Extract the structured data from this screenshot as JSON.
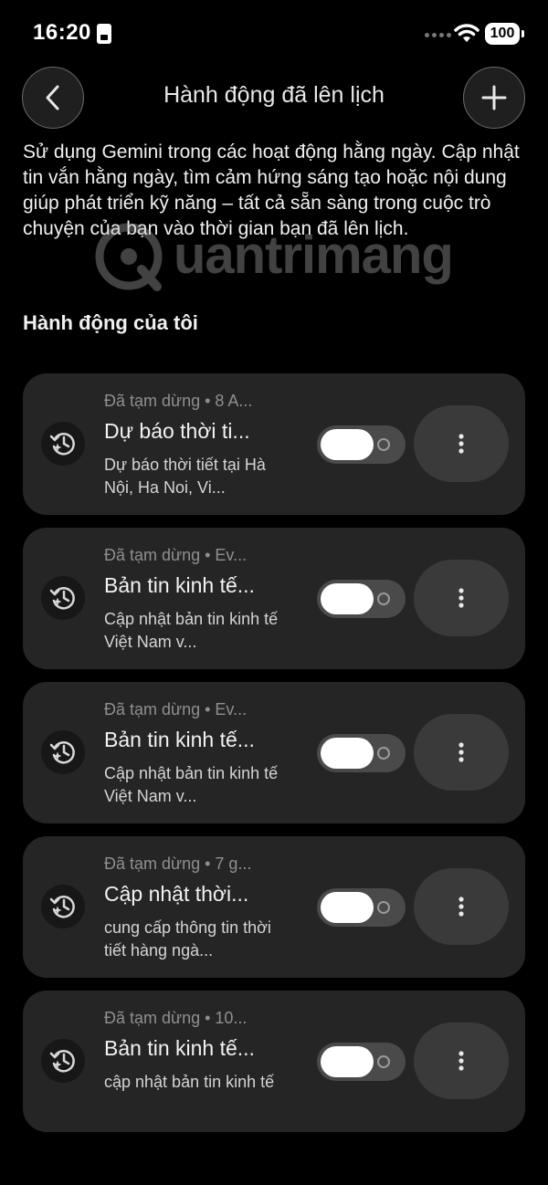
{
  "status_bar": {
    "time": "16:20",
    "battery": "100"
  },
  "header": {
    "title": "Hành động đã lên lịch"
  },
  "intro": "Sử dụng Gemini trong các hoạt động hằng ngày. Cập nhật tin vắn hằng ngày, tìm cảm hứng sáng tạo hoặc nội dung giúp phát triển kỹ năng – tất cả sẵn sàng trong cuộc trò chuyện của bạn vào thời gian bạn đã lên lịch.",
  "watermark": "uantrimang",
  "section_title": "Hành động của tôi",
  "actions": [
    {
      "meta": "Đã tạm dừng • 8 A...",
      "title": "Dự báo thời ti...",
      "desc": "Dự báo thời tiết tại Hà Nội, Ha Noi, Vi...",
      "enabled": false
    },
    {
      "meta": "Đã tạm dừng • Ev...",
      "title": "Bản tin kinh tế...",
      "desc": "Cập nhật bản tin kinh tế Việt Nam v...",
      "enabled": false
    },
    {
      "meta": "Đã tạm dừng • Ev...",
      "title": "Bản tin kinh tế...",
      "desc": "Cập nhật bản tin kinh tế Việt Nam v...",
      "enabled": false
    },
    {
      "meta": "Đã tạm dừng • 7 g...",
      "title": "Cập nhật thời...",
      "desc": "cung cấp thông tin thời tiết hàng ngà...",
      "enabled": false
    },
    {
      "meta": "Đã tạm dừng • 10...",
      "title": "Bản tin kinh tế...",
      "desc": "cập nhật bản tin kinh tế",
      "enabled": false
    }
  ]
}
